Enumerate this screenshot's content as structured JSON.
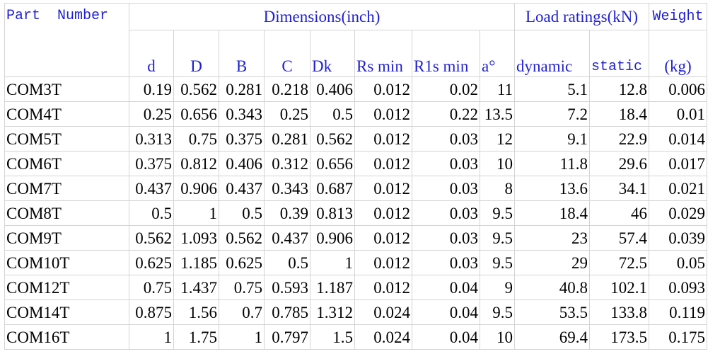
{
  "header": {
    "part_number": "Part  Number",
    "dimensions": "Dimensions(inch)",
    "load_ratings": "Load ratings(kN)",
    "weight": "Weight",
    "weight_unit": "(kg)"
  },
  "columns": [
    "d",
    "D",
    "B",
    "C",
    "Dk",
    "Rs min",
    "R1s min",
    "a°",
    "dynamic",
    "static"
  ],
  "rows": [
    [
      "COM3T",
      "0.19",
      "0.562",
      "0.281",
      "0.218",
      "0.406",
      "0.012",
      "0.02",
      "11",
      "5.1",
      "12.8",
      "0.006"
    ],
    [
      "COM4T",
      "0.25",
      "0.656",
      "0.343",
      "0.25",
      "0.5",
      "0.012",
      "0.22",
      "13.5",
      "7.2",
      "18.4",
      "0.01"
    ],
    [
      "COM5T",
      "0.313",
      "0.75",
      "0.375",
      "0.281",
      "0.562",
      "0.012",
      "0.03",
      "12",
      "9.1",
      "22.9",
      "0.014"
    ],
    [
      "COM6T",
      "0.375",
      "0.812",
      "0.406",
      "0.312",
      "0.656",
      "0.012",
      "0.03",
      "10",
      "11.8",
      "29.6",
      "0.017"
    ],
    [
      "COM7T",
      "0.437",
      "0.906",
      "0.437",
      "0.343",
      "0.687",
      "0.012",
      "0.03",
      "8",
      "13.6",
      "34.1",
      "0.021"
    ],
    [
      "COM8T",
      "0.5",
      "1",
      "0.5",
      "0.39",
      "0.813",
      "0.012",
      "0.03",
      "9.5",
      "18.4",
      "46",
      "0.029"
    ],
    [
      "COM9T",
      "0.562",
      "1.093",
      "0.562",
      "0.437",
      "0.906",
      "0.012",
      "0.03",
      "9.5",
      "23",
      "57.4",
      "0.039"
    ],
    [
      "COM10T",
      "0.625",
      "1.185",
      "0.625",
      "0.5",
      "1",
      "0.012",
      "0.03",
      "9.5",
      "29",
      "72.5",
      "0.05"
    ],
    [
      "COM12T",
      "0.75",
      "1.437",
      "0.75",
      "0.593",
      "1.187",
      "0.012",
      "0.04",
      "9",
      "40.8",
      "102.1",
      "0.093"
    ],
    [
      "COM14T",
      "0.875",
      "1.56",
      "0.7",
      "0.785",
      "1.312",
      "0.024",
      "0.04",
      "9.5",
      "53.5",
      "133.8",
      "0.119"
    ],
    [
      "COM16T",
      "1",
      "1.75",
      "1",
      "0.797",
      "1.5",
      "0.024",
      "0.04",
      "10",
      "69.4",
      "173.5",
      "0.175"
    ]
  ]
}
